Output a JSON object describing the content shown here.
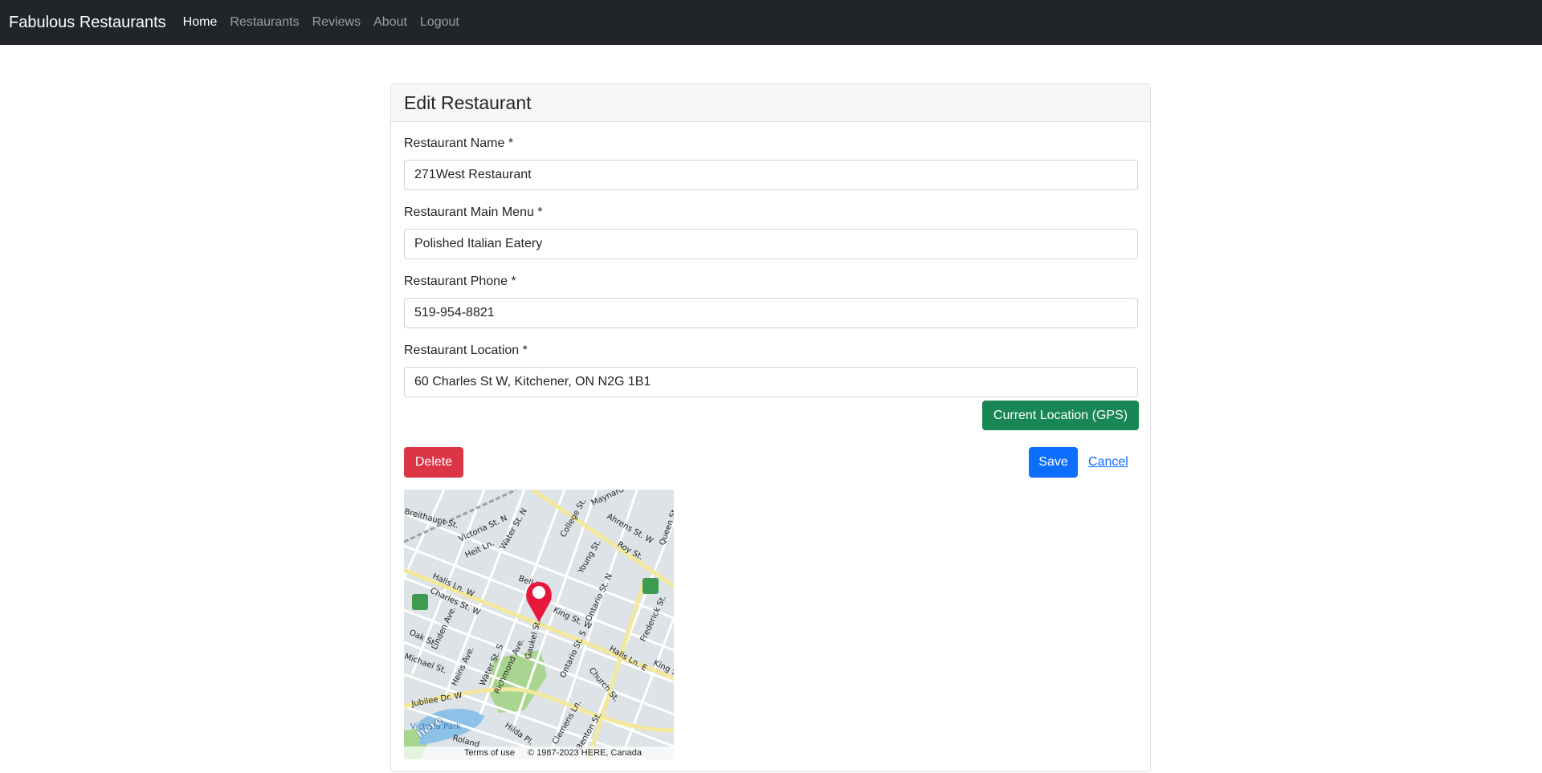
{
  "navbar": {
    "brand": "Fabulous Restaurants",
    "links": [
      "Home",
      "Restaurants",
      "Reviews",
      "About",
      "Logout"
    ],
    "active": "Home"
  },
  "form": {
    "title": "Edit Restaurant",
    "fields": [
      {
        "label": "Restaurant Name *",
        "value": "271West Restaurant"
      },
      {
        "label": "Restaurant Main Menu *",
        "value": "Polished Italian Eatery"
      },
      {
        "label": "Restaurant Phone *",
        "value": "519-954-8821"
      },
      {
        "label": "Restaurant Location *",
        "value": "60 Charles St W, Kitchener, ON N2G 1B1"
      }
    ],
    "gps_label": "Current Location (GPS)",
    "delete_label": "Delete",
    "save_label": "Save",
    "cancel_label": "Cancel"
  },
  "map": {
    "terms": "Terms of use",
    "copyright": "© 1987-2023 HERE, Canada",
    "logo": "here",
    "streets": [
      "Victoria St. N",
      "Water St. N",
      "College St.",
      "Maynard Ave.",
      "Ahrens St. W",
      "Heit Ln.",
      "Roy St.",
      "Young St.",
      "Bell Ln.",
      "Halls Ln. W",
      "Charles St. W",
      "King St. W",
      "Ontario St. N",
      "Frederick St.",
      "Oak St.",
      "Linden Ave.",
      "Heins Ave.",
      "Water St. S",
      "Richmond Ave.",
      "Gaukel St.",
      "Ontario St. S",
      "Halls Ln. E",
      "King St.",
      "Church St.",
      "Jubilee Dr. W",
      "Victoria Park",
      "Clemens Ln.",
      "Hilda Pl.",
      "Benton St.",
      "Roland",
      "Queen St.",
      "Breithaupt St.",
      "Michael St."
    ],
    "colors": {
      "pin": "#e8173c",
      "park": "#a8d58f",
      "water": "#8cc2e8",
      "major_road": "#f4e89c",
      "minor_road": "#ffffff",
      "background": "#dde3e6"
    }
  }
}
